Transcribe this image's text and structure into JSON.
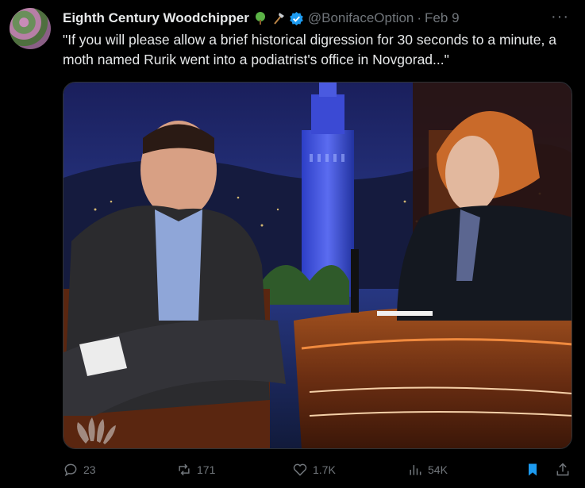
{
  "tweet": {
    "author_name": "Eighth Century Woodchipper",
    "name_emojis": [
      "tree-emoji",
      "axe-emoji"
    ],
    "handle": "@BonifaceOption",
    "separator": "·",
    "date": "Feb 9",
    "text": "\"If you will please allow a brief historical digression for 30 seconds to a minute, a moth named Rurik went into a podiatrist's office in Novgorad...\"",
    "more_label": "···",
    "media": {
      "type": "video-still",
      "watermark": "NBC peacock logo"
    },
    "actions": {
      "replies": "23",
      "reposts": "171",
      "likes": "1.7K",
      "views": "54K"
    },
    "colors": {
      "background": "#000000",
      "text": "#e7e9ea",
      "muted": "#71767b",
      "verified": "#1d9bf0",
      "bookmark": "#1d9bf0"
    }
  }
}
